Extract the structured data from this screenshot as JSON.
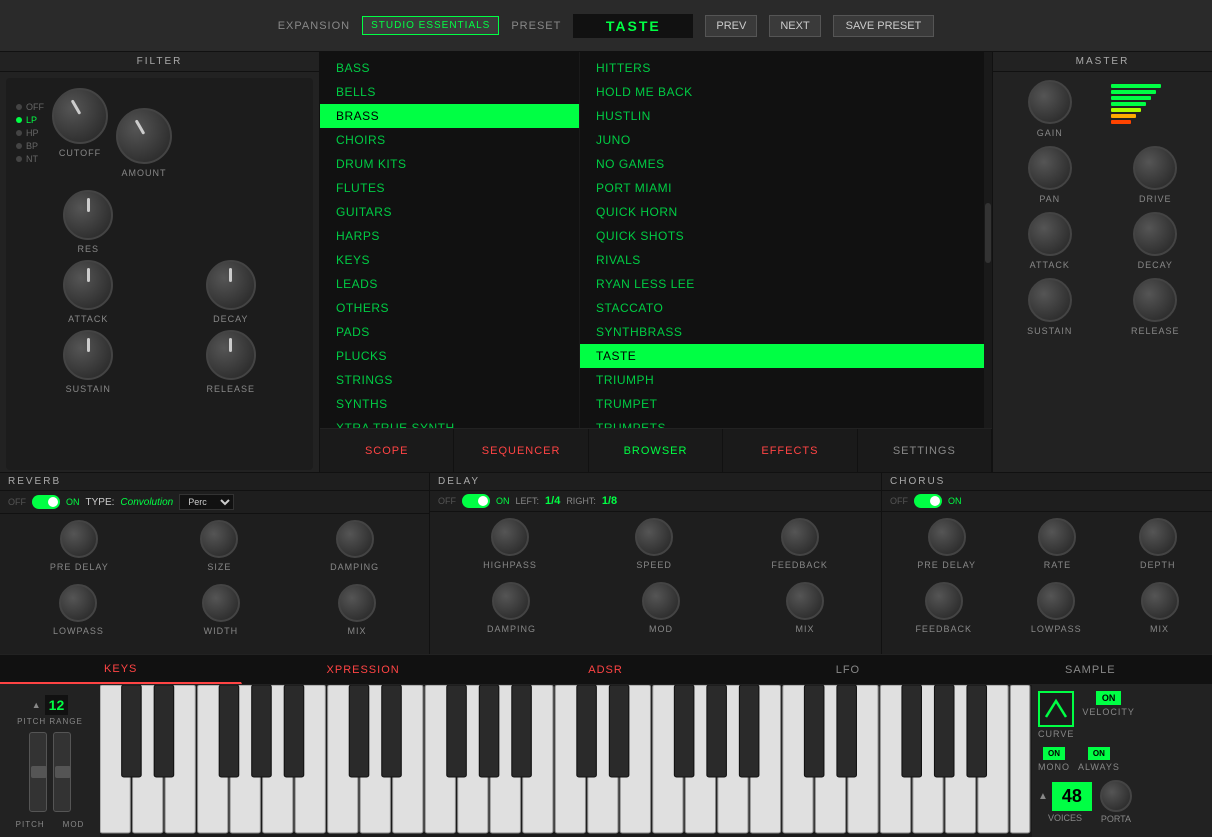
{
  "topbar": {
    "expansion_label": "EXPANSION",
    "expansion_value": "STUDIO ESSENTIALS",
    "preset_label": "PRESET",
    "preset_value": "TASTE",
    "prev_label": "PREV",
    "next_label": "NEXT",
    "save_label": "SAVE PRESET"
  },
  "filter": {
    "title": "FILTER",
    "options": [
      "OFF",
      "LP",
      "HP",
      "BP",
      "NT"
    ],
    "knobs": [
      "CUTOFF",
      "AMOUNT",
      "RES",
      "ATTACK",
      "DECAY",
      "SUSTAIN",
      "RELEASE"
    ]
  },
  "browser": {
    "categories": [
      "BASS",
      "BELLS",
      "BRASS",
      "CHOIRS",
      "DRUM KITS",
      "FLUTES",
      "GUITARS",
      "HARPS",
      "KEYS",
      "LEADS",
      "OTHERS",
      "PADS",
      "PLUCKS",
      "STRINGS",
      "SYNTHS",
      "XTRA TRUE SYNTH"
    ],
    "active_category": "BRASS",
    "presets": [
      "HITTERS",
      "HOLD ME BACK",
      "HUSTLIN",
      "JUNO",
      "NO GAMES",
      "PORT MIAMI",
      "QUICK HORN",
      "QUICK SHOTS",
      "RIVALS",
      "RYAN LESS LEE",
      "STACCATO",
      "SYNTHBRASS",
      "TASTE",
      "TRIUMPH",
      "TRUMPET",
      "TRUMPETS"
    ],
    "active_preset": "TASTE",
    "tabs": [
      "SCOPE",
      "SEQUENCER",
      "BROWSER",
      "EFFECTS",
      "SETTINGS"
    ],
    "active_tab": "BROWSER"
  },
  "master": {
    "title": "MASTER",
    "knobs": [
      "GAIN",
      "PAN",
      "DRIVE",
      "ATTACK",
      "DECAY",
      "SUSTAIN",
      "RELEASE"
    ]
  },
  "reverb": {
    "title": "REVERB",
    "off_label": "OFF",
    "on_label": "ON",
    "type_label": "TYPE:",
    "type_value": "Convolution",
    "type_preset": "Perc",
    "knobs": [
      "PRE DELAY",
      "SIZE",
      "DAMPING",
      "LOWPASS",
      "WIDTH",
      "MIX"
    ]
  },
  "delay": {
    "title": "DELAY",
    "off_label": "OFF",
    "on_label": "ON",
    "left_label": "LEFT:",
    "left_value": "1/4",
    "right_label": "RIGHT:",
    "right_value": "1/8",
    "knobs": [
      "HIGHPASS",
      "SPEED",
      "FEEDBACK",
      "DAMPING",
      "MOD",
      "MIX"
    ]
  },
  "chorus": {
    "title": "CHORUS",
    "off_label": "OFF",
    "on_label": "ON",
    "knobs": [
      "PRE DELAY",
      "RATE",
      "DEPTH",
      "FEEDBACK",
      "LOWPASS",
      "MIX"
    ]
  },
  "bottom": {
    "tabs": [
      "KEYS",
      "XPRESSION",
      "ADSR",
      "LFO",
      "SAMPLE"
    ],
    "active_tab": "KEYS"
  },
  "keyboard": {
    "pitch_range_label": "PITCH RANGE",
    "pitch_range_value": "12",
    "pitch_label": "PITCH",
    "mod_label": "MOD"
  },
  "right_controls": {
    "curve_label": "CURVE",
    "velocity_label": "VELOCITY",
    "velocity_on": "ON",
    "mono_label": "MONO",
    "mono_on": "ON",
    "always_label": "ALWAYS",
    "always_on": "ON",
    "voices_label": "VOICES",
    "voices_value": "48",
    "porta_label": "PORTA"
  }
}
